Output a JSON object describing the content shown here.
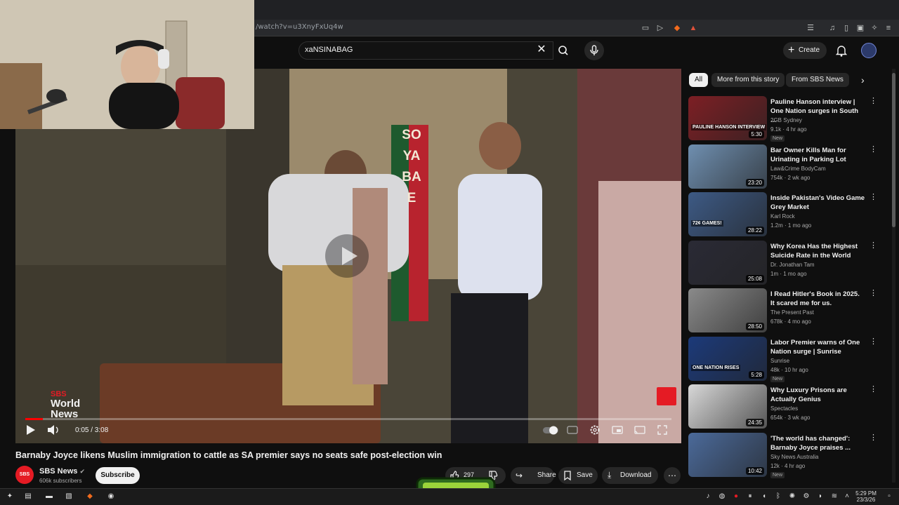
{
  "browser": {
    "url": "/watch?v=u3XnyFxUq4w"
  },
  "header": {
    "search_value": "xaNSINABAG",
    "create_label": "Create"
  },
  "player": {
    "time": "0:05 / 3:08",
    "progress_fraction": 0.027,
    "logo_line1": "SBS",
    "logo_line2": "World",
    "logo_line3": "News",
    "sign_text": "SOYABAE"
  },
  "video": {
    "title": "Barnaby Joyce likens Muslim immigration to cattle as SA premier says no seats safe post-election win",
    "channel": "SBS News",
    "channel_avatar_text": "SBS",
    "subscribers": "606k subscribers",
    "subscribe_label": "Subscribe",
    "likes": "297",
    "share_label": "Share",
    "save_label": "Save",
    "download_label": "Download"
  },
  "chips": [
    "All",
    "More from this story",
    "From SBS News"
  ],
  "recommendations": [
    {
      "title": "Pauline Hanson interview | One Nation surges in South ...",
      "channel": "2GB Sydney",
      "meta": "9.1k · 4 hr ago",
      "duration": "5:30",
      "new": "New",
      "thumb_color": "#7d1f24",
      "thumb_text": "PAULINE HANSON INTERVIEW"
    },
    {
      "title": "Bar Owner Kills Man for Urinating in Parking Lot",
      "channel": "Law&Crime BodyCam",
      "meta": "754k · 2 wk ago",
      "duration": "23:20",
      "new": "",
      "thumb_color": "#6f8fb0",
      "thumb_text": ""
    },
    {
      "title": "Inside Pakistan's Video Game Grey Market",
      "channel": "Karl Rock",
      "meta": "1.2m · 1 mo ago",
      "duration": "28:22",
      "new": "",
      "thumb_color": "#3d5a85",
      "thumb_text": "72¢ GAMES!"
    },
    {
      "title": "Why Korea Has the Highest Suicide Rate in the World",
      "channel": "Dr. Jonathan Tam",
      "meta": "1m · 1 mo ago",
      "duration": "25:08",
      "new": "",
      "thumb_color": "#2a2a35",
      "thumb_text": ""
    },
    {
      "title": "I Read Hitler's Book in 2025. It scared me for us.",
      "channel": "The Present Past",
      "meta": "678k · 4 mo ago",
      "duration": "28:50",
      "new": "",
      "thumb_color": "#8a8a8a",
      "thumb_text": ""
    },
    {
      "title": "Labor Premier warns of One Nation surge | Sunrise",
      "channel": "Sunrise",
      "meta": "48k · 10 hr ago",
      "duration": "5:28",
      "new": "New",
      "thumb_color": "#1c3a7a",
      "thumb_text": "ONE NATION RISES"
    },
    {
      "title": "Why Luxury Prisons are Actually Genius",
      "channel": "Spectacles",
      "meta": "654k · 3 wk ago",
      "duration": "24:35",
      "new": "",
      "thumb_color": "#d8d8d8",
      "thumb_text": ""
    },
    {
      "title": "'The world has changed': Barnaby Joyce praises ...",
      "channel": "Sky News Australia",
      "meta": "12k · 4 hr ago",
      "duration": "10:42",
      "new": "New",
      "thumb_color": "#4b6a9a",
      "thumb_text": ""
    }
  ],
  "taskbar": {
    "time": "5:29 PM",
    "date": "23/3/26"
  },
  "colors": {
    "accent_red": "#ff0000",
    "background": "#0f0f0f",
    "sbs_red": "#e51b24"
  }
}
